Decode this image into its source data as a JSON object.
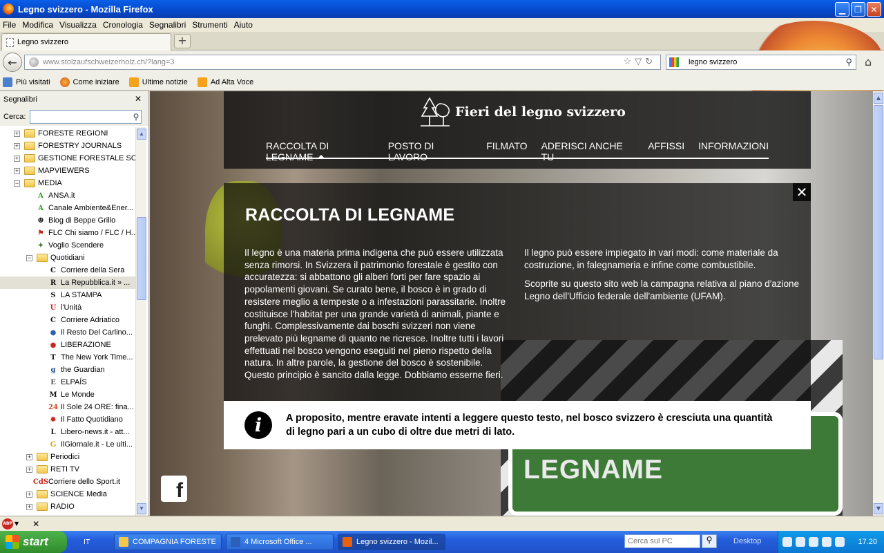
{
  "window": {
    "title": "Legno svizzero - Mozilla Firefox",
    "min": "▁",
    "max": "❐",
    "close": "✕"
  },
  "menu": [
    "File",
    "Modifica",
    "Visualizza",
    "Cronologia",
    "Segnalibri",
    "Strumenti",
    "Aiuto"
  ],
  "tab": {
    "label": "Legno svizzero",
    "new_tab": "+"
  },
  "nav": {
    "url_domain": "www.stolzaufschweizerholz.ch",
    "url_path": "/?lang=3",
    "search_value": "legno svizzero"
  },
  "bookmarks_toolbar": [
    "Più visitati",
    "Come iniziare",
    "Ultime notizie",
    "Ad Alta Voce"
  ],
  "sidebar": {
    "title": "Segnalibri",
    "search_label": "Cerca:",
    "items": [
      {
        "label": "FORESTE REGIONI",
        "type": "folder",
        "level": 0,
        "expander": "+"
      },
      {
        "label": "FORESTRY JOURNALS",
        "type": "folder",
        "level": 0,
        "expander": "+"
      },
      {
        "label": "GESTIONE FORESTALE SO...",
        "type": "folder",
        "level": 0,
        "expander": "+"
      },
      {
        "label": "MAPVIEWERS",
        "type": "folder",
        "level": 0,
        "expander": "+"
      },
      {
        "label": "MEDIA",
        "type": "folder",
        "level": 0,
        "expander": "−"
      },
      {
        "label": "ANSA.it",
        "type": "link",
        "level": 1,
        "icon": "A",
        "color": "#3a9a2c"
      },
      {
        "label": "Canale Ambiente&Ener...",
        "type": "link",
        "level": 1,
        "icon": "A",
        "color": "#3a9a2c"
      },
      {
        "label": "Blog di Beppe Grillo",
        "type": "link",
        "level": 1,
        "icon": "☻",
        "color": "#222222"
      },
      {
        "label": "FLC Chi siamo / FLC / H...",
        "type": "link",
        "level": 1,
        "icon": "⚑",
        "color": "#c8271f"
      },
      {
        "label": "Voglio Scendere",
        "type": "link",
        "level": 1,
        "icon": "✦",
        "color": "#3a7a2c"
      },
      {
        "label": "Quotidiani",
        "type": "folder",
        "level": 1,
        "expander": "−"
      },
      {
        "label": "Corriere della Sera",
        "type": "link",
        "level": 2,
        "icon": "C",
        "color": "#111111"
      },
      {
        "label": "La Repubblica.it » ...",
        "type": "link",
        "level": 2,
        "icon": "R",
        "color": "#111111",
        "selected": true
      },
      {
        "label": "LA STAMPA",
        "type": "link",
        "level": 2,
        "icon": "S",
        "color": "#111111"
      },
      {
        "label": "l'Unità",
        "type": "link",
        "level": 2,
        "icon": "U",
        "color": "#c8271f"
      },
      {
        "label": "Corriere Adriatico",
        "type": "link",
        "level": 2,
        "icon": "C",
        "color": "#111111"
      },
      {
        "label": "Il Resto Del Carlino...",
        "type": "link",
        "level": 2,
        "icon": "●",
        "color": "#2b5fb8"
      },
      {
        "label": "LIBERAZIONE",
        "type": "link",
        "level": 2,
        "icon": "●",
        "color": "#c8271f"
      },
      {
        "label": "The New York Time...",
        "type": "link",
        "level": 2,
        "icon": "T",
        "color": "#111111"
      },
      {
        "label": "the Guardian",
        "type": "link",
        "level": 2,
        "icon": "g",
        "color": "#1f4a8c"
      },
      {
        "label": "ELPAÍS",
        "type": "link",
        "level": 2,
        "icon": "E",
        "color": "#555555"
      },
      {
        "label": "Le Monde",
        "type": "link",
        "level": 2,
        "icon": "M",
        "color": "#111111"
      },
      {
        "label": "Il Sole 24 ORE: fina...",
        "type": "link",
        "level": 2,
        "icon": "24",
        "color": "#d3451f"
      },
      {
        "label": "Il Fatto Quotidiano",
        "type": "link",
        "level": 2,
        "icon": "✹",
        "color": "#c8271f"
      },
      {
        "label": "Libero-news.it - att...",
        "type": "link",
        "level": 2,
        "icon": "L",
        "color": "#111111"
      },
      {
        "label": "IlGiornale.it - Le ulti...",
        "type": "link",
        "level": 2,
        "icon": "G",
        "color": "#d4a017"
      },
      {
        "label": "Periodici",
        "type": "folder",
        "level": 1,
        "expander": "+"
      },
      {
        "label": "RETI TV",
        "type": "folder",
        "level": 1,
        "expander": "+"
      },
      {
        "label": "Corriere dello Sport.it",
        "type": "link",
        "level": 1,
        "icon": "CdS",
        "color": "#c8271f"
      },
      {
        "label": "SCIENCE Media",
        "type": "folder",
        "level": 1,
        "expander": "+"
      },
      {
        "label": "RADIO",
        "type": "folder",
        "level": 1,
        "expander": "+"
      }
    ]
  },
  "site": {
    "brand": "Fieri del legno svizzero",
    "nav": [
      "RACCOLTA DI LEGNAME",
      "POSTO DI LAVORO",
      "FILMATO",
      "ADERISCI ANCHE TU",
      "AFFISSI",
      "INFORMAZIONI"
    ],
    "panel_close": "✕",
    "heading": "RACCOLTA DI LEGNAME",
    "col1": "Il legno è una materia prima indigena che può essere utilizzata senza rimorsi. In Svizzera il patrimonio forestale è gestito con accuratezza: si abbattono gli alberi forti per fare spazio ai popolamenti giovani. Se curato bene, il bosco è in grado di resistere meglio a tempeste o a infestazioni parassitarie. Inoltre costituisce l'habitat per una grande varietà di animali, piante e funghi. Complessivamente dai boschi svizzeri non viene prelevato più legname di quanto ne ricresce. Inoltre tutti i lavori effettuati nel bosco vengono eseguiti nel pieno rispetto della natura. In altre parole, la gestione del bosco è sostenibile. Questo principio è sancito dalla legge. Dobbiamo esserne fieri.",
    "col2_p1": "Il legno può essere impiegato in vari modi: come materiale da costruzione, in falegnameria e infine come combustibile.",
    "col2_p2": "Scoprite su questo sito web la campagna relativa al piano d'azione Legno dell'Ufficio federale dell'ambiente (UFAM).",
    "info_icon": "i",
    "info_text": "A proposito, mentre eravate intenti a leggere questo testo, nel bosco svizzero è cresciuta una quantità di legno pari a un cubo di oltre due metri di lato.",
    "sign_text": "RACCOLTA DEL LEGNAME",
    "facebook": "f"
  },
  "statusbar": {
    "abp": "ABP",
    "close": "✕"
  },
  "taskbar": {
    "start": "start",
    "lang": "IT",
    "buttons": [
      {
        "label": "COMPAGNIA FORESTE",
        "width": 156,
        "icon_color": "#f3c74b",
        "active": false
      },
      {
        "label": "4 Microsoft Office ...",
        "width": 156,
        "icon_color": "#2b5fb8",
        "active": false
      },
      {
        "label": "Legno svizzero - Mozil...",
        "width": 156,
        "icon_color": "#e8610e",
        "active": true
      }
    ],
    "search_placeholder": "Cerca sul PC",
    "desktop": "Desktop",
    "clock": "17.20"
  }
}
